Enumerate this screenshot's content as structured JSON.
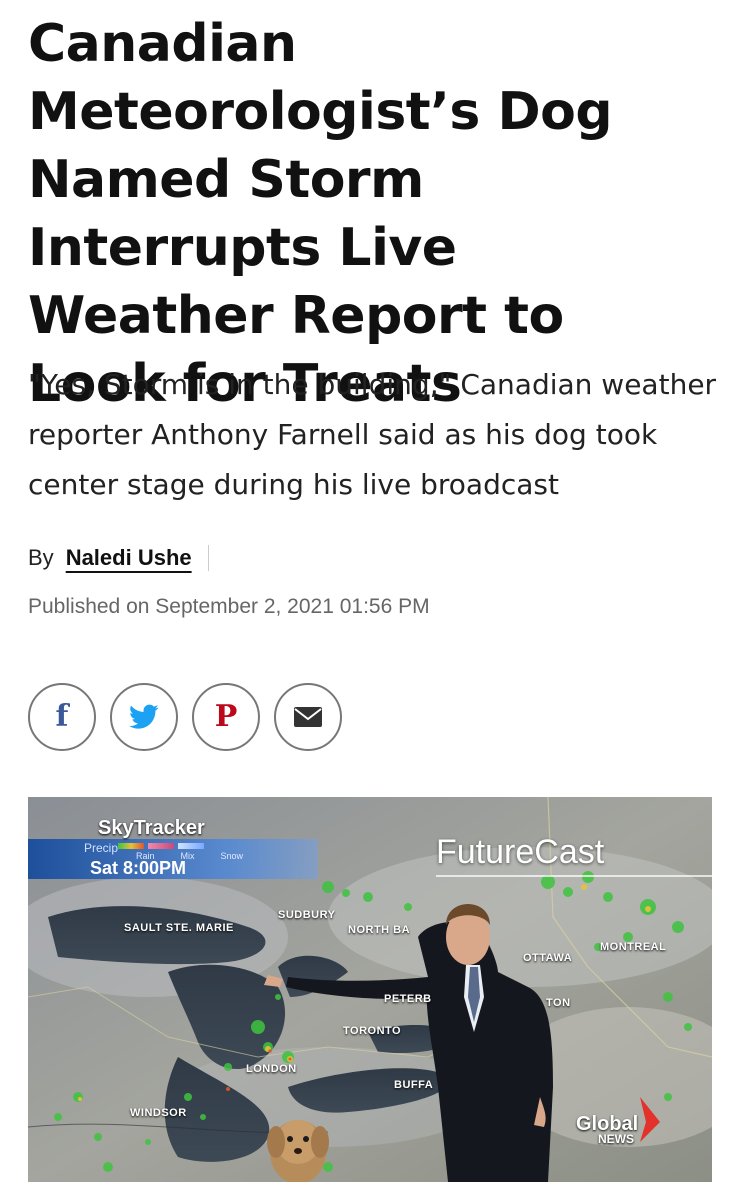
{
  "article": {
    "headline": "Canadian Meteorologist’s Dog Named Storm Interrupts Live Weather Report to Look for Treats",
    "dek": "\"Yes, Storm is in the building,\" Canadian weather reporter Anthony Farnell said as his dog took center stage during his live broadcast",
    "byline_prefix": "By",
    "author": "Naledi Ushe",
    "published": "Published on September 2, 2021 01:56 PM"
  },
  "share": [
    {
      "name": "facebook",
      "glyph": "f",
      "icon": "facebook-icon",
      "color": "#3b5998"
    },
    {
      "name": "twitter",
      "icon": "twitter-icon",
      "color": "#1da1f2"
    },
    {
      "name": "pinterest",
      "glyph": "P",
      "icon": "pinterest-icon",
      "color": "#bd081c"
    },
    {
      "name": "email",
      "icon": "email-icon",
      "color": "#333333"
    }
  ],
  "hero": {
    "skytracker": "SkyTracker",
    "precip_label": "Precip",
    "legend": [
      "Rain",
      "Mix",
      "Snow"
    ],
    "time": "Sat 8:00PM",
    "futurecast": "FutureCast",
    "cities": [
      "SUDBURY",
      "SAULT STE. MARIE",
      "NORTH BA",
      "OTTAWA",
      "MONTREAL",
      "PETERB",
      "TON",
      "TORONTO",
      "LONDON",
      "BUFFA",
      "WINDSOR"
    ],
    "brand_top": "Global",
    "brand_bottom": "NEWS"
  }
}
